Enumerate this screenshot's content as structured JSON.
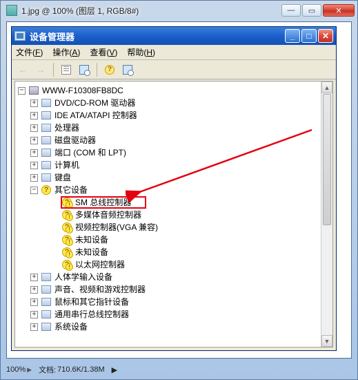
{
  "outer": {
    "title": "1.jpg @ 100% (图层 1, RGB/8#)",
    "min": "—",
    "max": "▭",
    "close": "✕"
  },
  "status": {
    "zoom": "100%",
    "doc_label": "文档:",
    "doc_value": "710.6K/1.38M",
    "more": "▶"
  },
  "xp": {
    "title": "设备管理器",
    "min": "_",
    "max": "□",
    "close": "✕",
    "menu": {
      "file": "文件(",
      "file_k": "F",
      "file_e": ")",
      "action": "操作(",
      "action_k": "A",
      "action_e": ")",
      "view": "查看(",
      "view_k": "V",
      "view_e": ")",
      "help": "帮助(",
      "help_k": "H",
      "help_e": ")"
    }
  },
  "tree": {
    "root": "WWW-F10308FB8DC",
    "items": [
      "DVD/CD-ROM 驱动器",
      "IDE ATA/ATAPI 控制器",
      "处理器",
      "磁盘驱动器",
      "端口 (COM 和 LPT)",
      "计算机",
      "键盘"
    ],
    "other_devices": "其它设备",
    "other_children": [
      "SM 总线控制器",
      "多媒体音频控制器",
      "视频控制器(VGA 兼容)",
      "未知设备",
      "未知设备",
      "以太网控制器"
    ],
    "items_after": [
      "人体学输入设备",
      "声音、视频和游戏控制器",
      "鼠标和其它指针设备",
      "通用串行总线控制器",
      "系统设备"
    ]
  },
  "glyphs": {
    "back": "←",
    "fwd": "→",
    "q": "?",
    "plus": "+",
    "minus": "−",
    "up": "▲",
    "down": "▼"
  }
}
